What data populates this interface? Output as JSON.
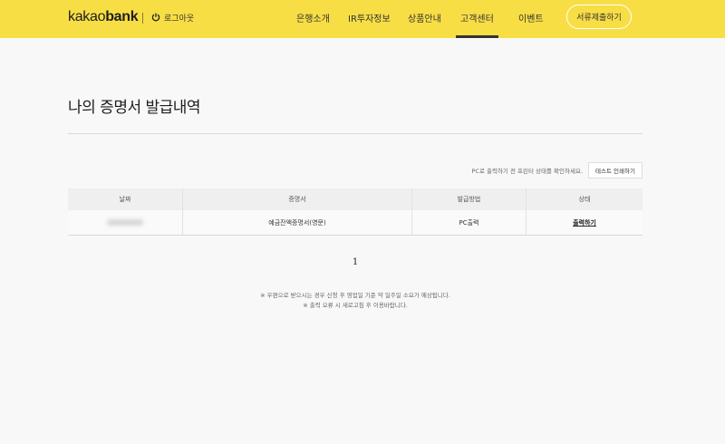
{
  "header": {
    "logo_kakao": "kakao",
    "logo_bank": "bank",
    "logout_label": "로그아웃",
    "nav": [
      "은행소개",
      "IR투자정보",
      "상품안내",
      "고객센터",
      "이벤트"
    ],
    "active_nav": "고객센터",
    "submit_label": "서류제출하기",
    "background_color": "#f7de45"
  },
  "page": {
    "title": "나의 증명서 발급내역",
    "notice": "PC로 출력하기 전 프린터 상태를 확인하세요.",
    "print_test_label": "테스트 인쇄하기"
  },
  "table": {
    "headers": [
      "날짜",
      "증명서",
      "발급방법",
      "상태"
    ],
    "rows": [
      {
        "cert": "예금잔액증명서(영문)",
        "method": "PC출력",
        "status": "출력하기"
      }
    ]
  },
  "pagination": {
    "current": "1"
  },
  "footnotes": [
    "※ 우편으로 받으시는 경우 신청 후 영업일 기준 약 일주일 소요가 예상됩니다.",
    "※ 출력 오류 시 새로고침 후 이용바랍니다."
  ]
}
